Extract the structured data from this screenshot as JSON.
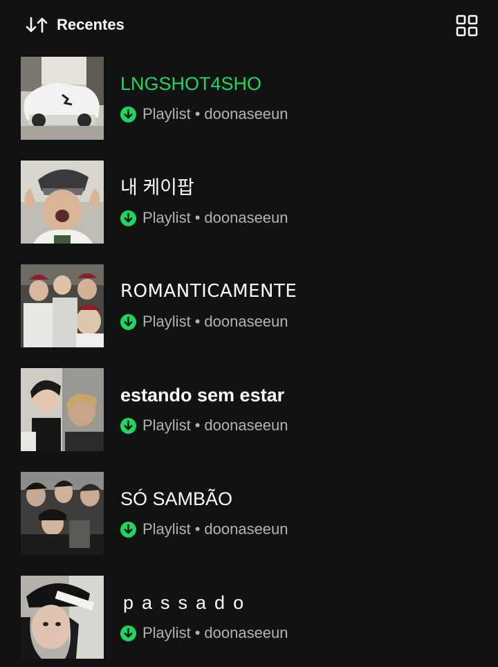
{
  "header": {
    "sort_label": "Recentes",
    "sort_icon": "sort-arrows-icon",
    "view_icon": "grid-view-icon"
  },
  "colors": {
    "background": "#121212",
    "accent": "#1ed760",
    "secondary_text": "#b3b3b3"
  },
  "playlists": [
    {
      "title": "LNGSHOT4SHO",
      "type": "Playlist",
      "separator": "•",
      "owner": "doonaseeun",
      "downloaded": true,
      "active": true
    },
    {
      "title": "내 케이팝",
      "type": "Playlist",
      "separator": "•",
      "owner": "doonaseeun",
      "downloaded": true,
      "active": false
    },
    {
      "title": "ROMANTICAMENTE",
      "type": "Playlist",
      "separator": "•",
      "owner": "doonaseeun",
      "downloaded": true,
      "active": false
    },
    {
      "title": "estando sem estar",
      "type": "Playlist",
      "separator": "•",
      "owner": "doonaseeun",
      "downloaded": true,
      "active": false
    },
    {
      "title": "SÓ SAMBÃO",
      "type": "Playlist",
      "separator": "•",
      "owner": "doonaseeun",
      "downloaded": true,
      "active": false
    },
    {
      "title": "passado",
      "type": "Playlist",
      "separator": "•",
      "owner": "doonaseeun",
      "downloaded": true,
      "active": false
    }
  ]
}
